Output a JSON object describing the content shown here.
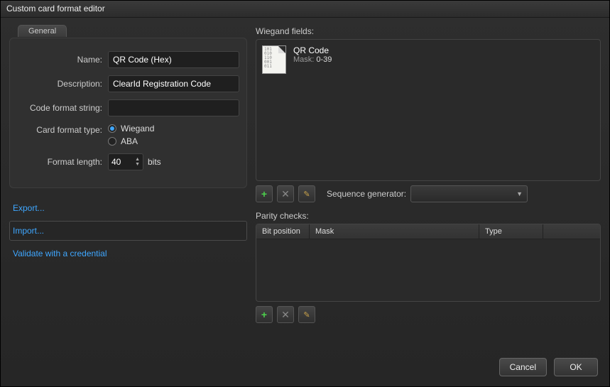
{
  "dialog": {
    "title": "Custom card format editor"
  },
  "general": {
    "legend": "General",
    "name_label": "Name:",
    "name_value": "QR Code (Hex)",
    "description_label": "Description:",
    "description_value": "ClearId Registration Code",
    "cfs_label": "Code format string:",
    "cfs_value": "",
    "cft_label": "Card format type:",
    "radio_wiegand": "Wiegand",
    "radio_aba": "ABA",
    "format_length_label": "Format length:",
    "format_length_value": "40",
    "format_length_unit": "bits"
  },
  "links": {
    "export": "Export...",
    "import": "Import...",
    "validate": "Validate with a credential"
  },
  "wiegand": {
    "section_label": "Wiegand fields:",
    "item_title": "QR Code",
    "item_mask_label": "Mask:",
    "item_mask_value": "0-39",
    "seq_label": "Sequence generator:"
  },
  "parity": {
    "section_label": "Parity checks:",
    "col_bit": "Bit position",
    "col_mask": "Mask",
    "col_type": "Type"
  },
  "footer": {
    "cancel": "Cancel",
    "ok": "OK"
  }
}
